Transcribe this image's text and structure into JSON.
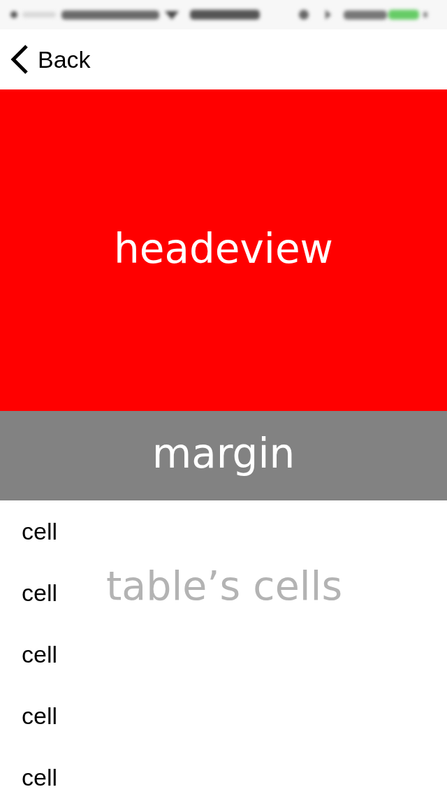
{
  "nav_bar": {
    "back_button": {
      "label": "Back"
    }
  },
  "header_view": {
    "label": "headeview"
  },
  "margin_view": {
    "label": "margin"
  },
  "table": {
    "overlay_label": "table’s cells",
    "rows": [
      {
        "label": "cell"
      },
      {
        "label": "cell"
      },
      {
        "label": "cell"
      },
      {
        "label": "cell"
      },
      {
        "label": "cell"
      }
    ]
  }
}
